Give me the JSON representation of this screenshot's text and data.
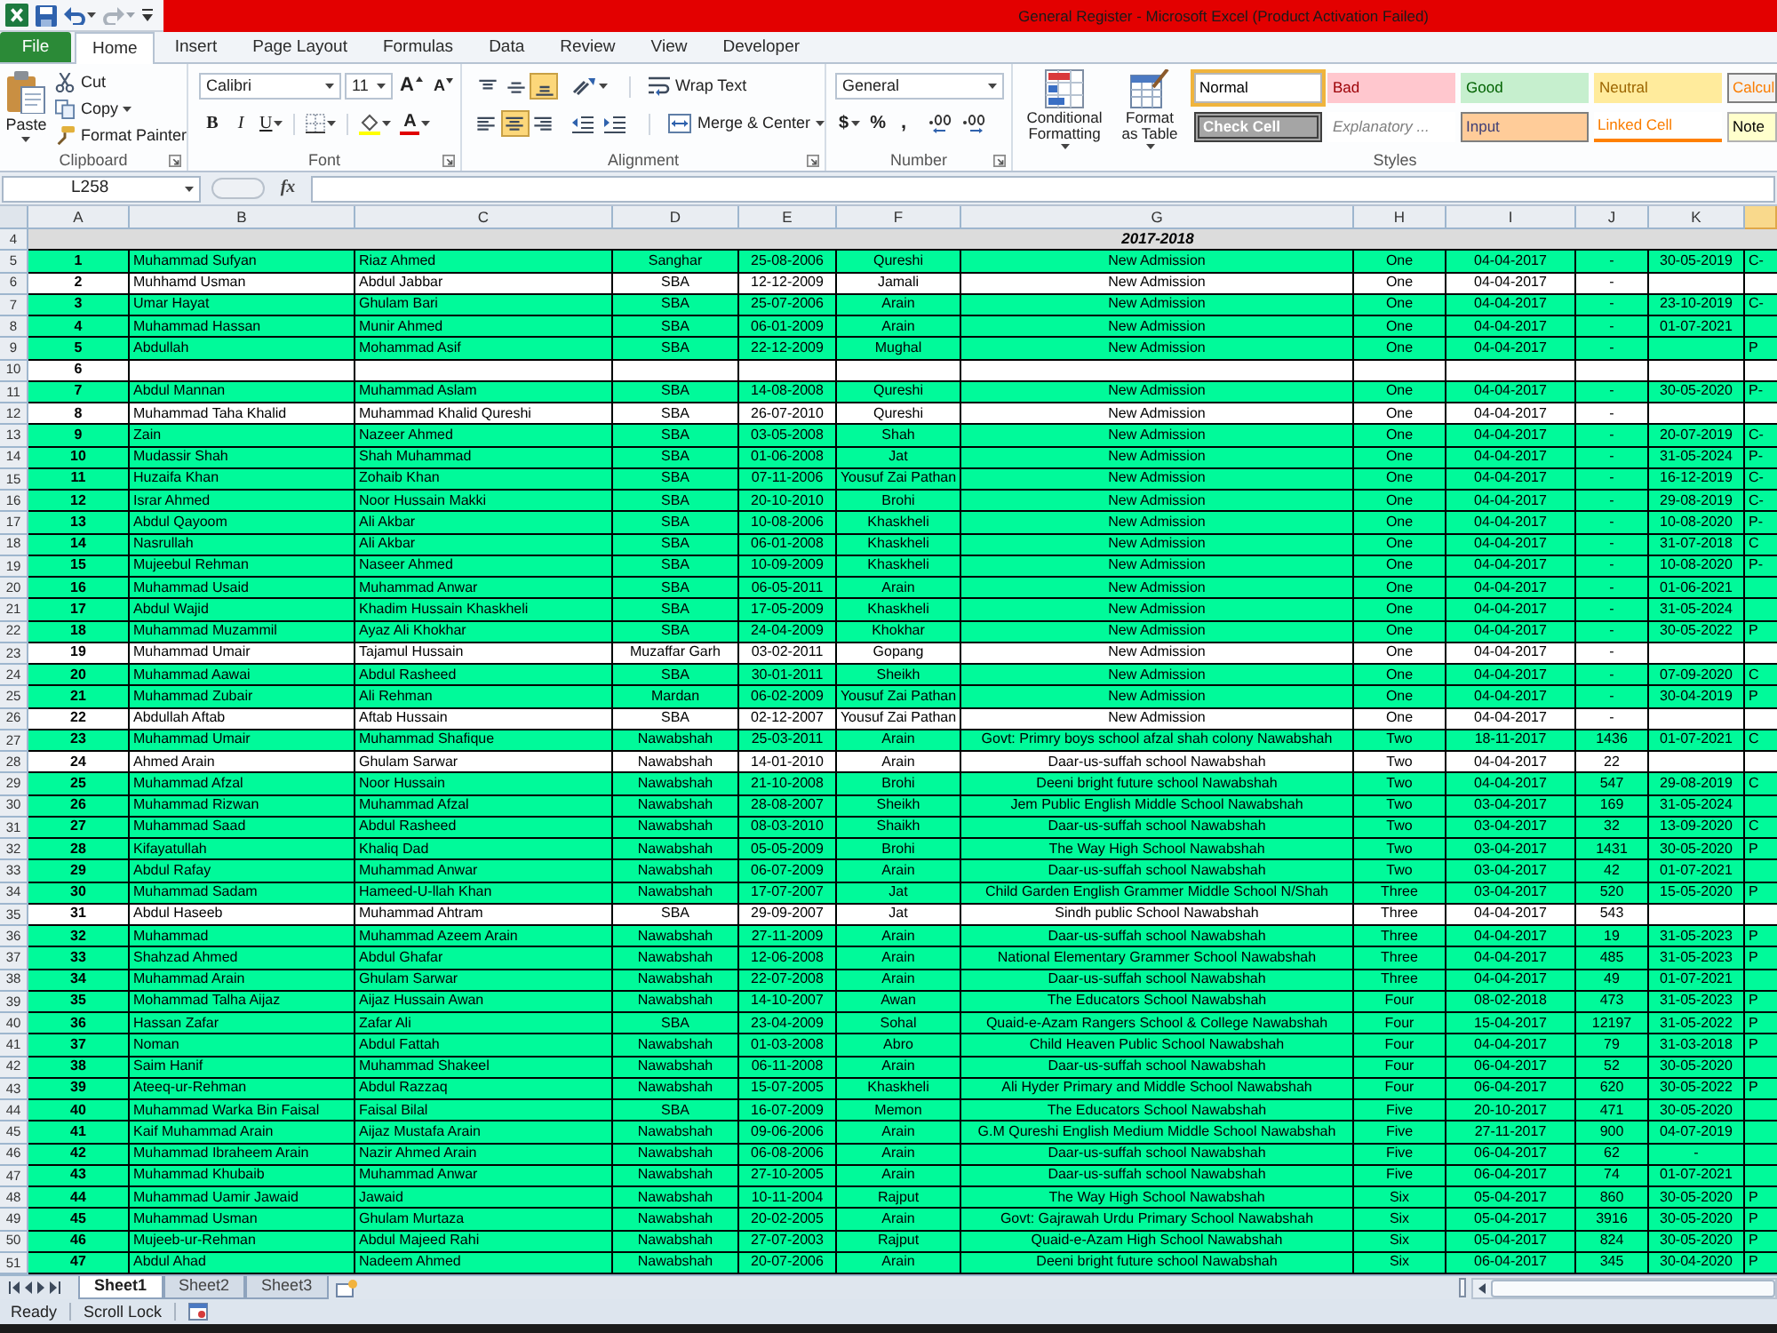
{
  "title_bar": {
    "title": "General Register - Microsoft Excel (Product Activation Failed)"
  },
  "ribbon_tabs": [
    {
      "label": "File",
      "kind": "file",
      "selected": false
    },
    {
      "label": "Home",
      "kind": "tab",
      "selected": true
    },
    {
      "label": "Insert",
      "kind": "tab",
      "selected": false
    },
    {
      "label": "Page Layout",
      "kind": "tab",
      "selected": false
    },
    {
      "label": "Formulas",
      "kind": "tab",
      "selected": false
    },
    {
      "label": "Data",
      "kind": "tab",
      "selected": false
    },
    {
      "label": "Review",
      "kind": "tab",
      "selected": false
    },
    {
      "label": "View",
      "kind": "tab",
      "selected": false
    },
    {
      "label": "Developer",
      "kind": "tab",
      "selected": false
    }
  ],
  "clipboard": {
    "group_label": "Clipboard",
    "paste": "Paste",
    "cut": "Cut",
    "copy": "Copy",
    "format_painter": "Format Painter"
  },
  "font": {
    "group_label": "Font",
    "font_name": "Calibri",
    "font_size": "11",
    "grow": "A",
    "shrink": "A",
    "bold": "B",
    "italic": "I",
    "underline": "U",
    "font_color": "A"
  },
  "alignment": {
    "group_label": "Alignment",
    "buttons": [
      {
        "kind": "top",
        "selected": false
      },
      {
        "kind": "middle",
        "selected": false
      },
      {
        "kind": "bottom",
        "selected": true
      },
      {
        "kind": "left",
        "selected": false
      },
      {
        "kind": "center",
        "selected": true
      },
      {
        "kind": "right",
        "selected": false
      }
    ],
    "wrap_text": "Wrap Text",
    "merge": "Merge & Center"
  },
  "number": {
    "group_label": "Number",
    "format": "General",
    "currency": "$",
    "percent": "%",
    "comma": ","
  },
  "styles": {
    "group_label": "Styles",
    "conditional_formatting": "Conditional Formatting",
    "format_as_table": "Format as Table",
    "cell_styles": [
      {
        "label": "Normal",
        "kind": "normal",
        "selected": true
      },
      {
        "label": "Bad",
        "kind": "bad",
        "selected": false
      },
      {
        "label": "Good",
        "kind": "good",
        "selected": false
      },
      {
        "label": "Neutral",
        "kind": "neutral",
        "selected": false
      },
      {
        "label": "Calcul",
        "kind": "calculation",
        "selected": false
      },
      {
        "label": "Check Cell",
        "kind": "check",
        "selected": false
      },
      {
        "label": "Explanatory ...",
        "kind": "explanatory",
        "selected": false
      },
      {
        "label": "Input",
        "kind": "input",
        "selected": false
      },
      {
        "label": "Linked Cell",
        "kind": "linked",
        "selected": false
      },
      {
        "label": "Note",
        "kind": "note",
        "selected": false
      }
    ]
  },
  "formula_bar": {
    "name_box": "L258",
    "function_label": "fx"
  },
  "columns": [
    {
      "label": "A",
      "selected": false
    },
    {
      "label": "B",
      "selected": false
    },
    {
      "label": "C",
      "selected": false
    },
    {
      "label": "D",
      "selected": false
    },
    {
      "label": "E",
      "selected": false
    },
    {
      "label": "F",
      "selected": false
    },
    {
      "label": "G",
      "selected": false
    },
    {
      "label": "H",
      "selected": false
    },
    {
      "label": "I",
      "selected": false
    },
    {
      "label": "J",
      "selected": false
    },
    {
      "label": "K",
      "selected": false
    },
    {
      "selected": true
    }
  ],
  "title_row": {
    "row_number": "4",
    "cells": {
      "g": "2017-2018"
    }
  },
  "rows": [
    {
      "row_number": "5",
      "highlighted": true,
      "cells": {
        "a": "1",
        "b": "Muhammad Sufyan",
        "c": "Riaz Ahmed",
        "d": "Sanghar",
        "e": "25-08-2006",
        "f": "Qureshi",
        "g": "New Admission",
        "h": "One",
        "i": "04-04-2017",
        "j": "-",
        "k": "30-05-2019",
        "l": "C-"
      }
    },
    {
      "row_number": "6",
      "highlighted": false,
      "cells": {
        "a": "2",
        "b": "Muhhamd Usman",
        "c": "Abdul Jabbar",
        "d": "SBA",
        "e": "12-12-2009",
        "f": "Jamali",
        "g": "New Admission",
        "h": "One",
        "i": "04-04-2017",
        "j": "-"
      }
    },
    {
      "row_number": "7",
      "highlighted": true,
      "cells": {
        "a": "3",
        "b": "Umar Hayat",
        "c": "Ghulam Bari",
        "d": "SBA",
        "e": "25-07-2006",
        "f": "Arain",
        "g": "New Admission",
        "h": "One",
        "i": "04-04-2017",
        "j": "-",
        "k": "23-10-2019",
        "l": "C-"
      }
    },
    {
      "row_number": "8",
      "highlighted": true,
      "cells": {
        "a": "4",
        "b": "Muhammad Hassan",
        "c": "Munir Ahmed",
        "d": "SBA",
        "e": "06-01-2009",
        "f": "Arain",
        "g": "New Admission",
        "h": "One",
        "i": "04-04-2017",
        "j": "-",
        "k": "01-07-2021"
      }
    },
    {
      "row_number": "9",
      "highlighted": true,
      "cells": {
        "a": "5",
        "b": "Abdullah",
        "c": "Mohammad Asif",
        "d": "SBA",
        "e": "22-12-2009",
        "f": "Mughal",
        "g": "New Admission",
        "h": "One",
        "i": "04-04-2017",
        "j": "-",
        "l": "P"
      }
    },
    {
      "row_number": "10",
      "highlighted": false,
      "cells": {
        "a": "6"
      }
    },
    {
      "row_number": "11",
      "highlighted": true,
      "cells": {
        "a": "7",
        "b": "Abdul Mannan",
        "c": "Muhammad Aslam",
        "d": "SBA",
        "e": "14-08-2008",
        "f": "Qureshi",
        "g": "New Admission",
        "h": "One",
        "i": "04-04-2017",
        "j": "-",
        "k": "30-05-2020",
        "l": "P-"
      }
    },
    {
      "row_number": "12",
      "highlighted": false,
      "cells": {
        "a": "8",
        "b": "Muhammad Taha Khalid",
        "c": "Muhammad Khalid Qureshi",
        "d": "SBA",
        "e": "26-07-2010",
        "f": "Qureshi",
        "g": "New Admission",
        "h": "One",
        "i": "04-04-2017",
        "j": "-"
      }
    },
    {
      "row_number": "13",
      "highlighted": true,
      "cells": {
        "a": "9",
        "b": "Zain",
        "c": "Nazeer Ahmed",
        "d": "SBA",
        "e": "03-05-2008",
        "f": "Shah",
        "g": "New Admission",
        "h": "One",
        "i": "04-04-2017",
        "j": "-",
        "k": "20-07-2019",
        "l": "C-"
      }
    },
    {
      "row_number": "14",
      "highlighted": true,
      "cells": {
        "a": "10",
        "b": "Mudassir Shah",
        "c": "Shah Muhammad",
        "d": "SBA",
        "e": "01-06-2008",
        "f": "Jat",
        "g": "New Admission",
        "h": "One",
        "i": "04-04-2017",
        "j": "-",
        "k": "31-05-2024",
        "l": "P-"
      }
    },
    {
      "row_number": "15",
      "highlighted": true,
      "cells": {
        "a": "11",
        "b": "Huzaifa Khan",
        "c": "Zohaib Khan",
        "d": "SBA",
        "e": "07-11-2006",
        "f": "Yousuf Zai Pathan",
        "g": "New Admission",
        "h": "One",
        "i": "04-04-2017",
        "j": "-",
        "k": "16-12-2019",
        "l": "C-"
      }
    },
    {
      "row_number": "16",
      "highlighted": true,
      "cells": {
        "a": "12",
        "b": "Israr Ahmed",
        "c": "Noor Hussain Makki",
        "d": "SBA",
        "e": "20-10-2010",
        "f": "Brohi",
        "g": "New Admission",
        "h": "One",
        "i": "04-04-2017",
        "j": "-",
        "k": "29-08-2019",
        "l": "C-"
      }
    },
    {
      "row_number": "17",
      "highlighted": true,
      "cells": {
        "a": "13",
        "b": "Abdul Qayoom",
        "c": "Ali Akbar",
        "d": "SBA",
        "e": "10-08-2006",
        "f": "Khaskheli",
        "g": "New Admission",
        "h": "One",
        "i": "04-04-2017",
        "j": "-",
        "k": "10-08-2020",
        "l": "P-"
      }
    },
    {
      "row_number": "18",
      "highlighted": true,
      "cells": {
        "a": "14",
        "b": "Nasrullah",
        "c": "Ali Akbar",
        "d": "SBA",
        "e": "06-01-2008",
        "f": "Khaskheli",
        "g": "New Admission",
        "h": "One",
        "i": "04-04-2017",
        "j": "-",
        "k": "31-07-2018",
        "l": "C"
      }
    },
    {
      "row_number": "19",
      "highlighted": true,
      "cells": {
        "a": "15",
        "b": "Mujeebul Rehman",
        "c": "Naseer Ahmed",
        "d": "SBA",
        "e": "10-09-2009",
        "f": "Khaskheli",
        "g": "New Admission",
        "h": "One",
        "i": "04-04-2017",
        "j": "-",
        "k": "10-08-2020",
        "l": "P-"
      }
    },
    {
      "row_number": "20",
      "highlighted": true,
      "cells": {
        "a": "16",
        "b": "Muhammad Usaid",
        "c": "Muhammad Anwar",
        "d": "SBA",
        "e": "06-05-2011",
        "f": "Arain",
        "g": "New Admission",
        "h": "One",
        "i": "04-04-2017",
        "j": "-",
        "k": "01-06-2021"
      }
    },
    {
      "row_number": "21",
      "highlighted": true,
      "cells": {
        "a": "17",
        "b": "Abdul Wajid",
        "c": "Khadim Hussain Khaskheli",
        "d": "SBA",
        "e": "17-05-2009",
        "f": "Khaskheli",
        "g": "New Admission",
        "h": "One",
        "i": "04-04-2017",
        "j": "-",
        "k": "31-05-2024"
      }
    },
    {
      "row_number": "22",
      "highlighted": true,
      "cells": {
        "a": "18",
        "b": "Muhammad Muzammil",
        "c": "Ayaz Ali Khokhar",
        "d": "SBA",
        "e": "24-04-2009",
        "f": "Khokhar",
        "g": "New Admission",
        "h": "One",
        "i": "04-04-2017",
        "j": "-",
        "k": "30-05-2022",
        "l": "P"
      }
    },
    {
      "row_number": "23",
      "highlighted": false,
      "cells": {
        "a": "19",
        "b": "Muhammad Umair",
        "c": "Tajamul Hussain",
        "d": "Muzaffar Garh",
        "e": "03-02-2011",
        "f": "Gopang",
        "g": "New Admission",
        "h": "One",
        "i": "04-04-2017",
        "j": "-"
      }
    },
    {
      "row_number": "24",
      "highlighted": true,
      "cells": {
        "a": "20",
        "b": "Muhammad Aawai",
        "c": "Abdul Rasheed",
        "d": "SBA",
        "e": "30-01-2011",
        "f": "Sheikh",
        "g": "New Admission",
        "h": "One",
        "i": "04-04-2017",
        "j": "-",
        "k": "07-09-2020",
        "l": "C"
      }
    },
    {
      "row_number": "25",
      "highlighted": true,
      "cells": {
        "a": "21",
        "b": "Muhammad Zubair",
        "c": "Ali Rehman",
        "d": "Mardan",
        "e": "06-02-2009",
        "f": "Yousuf Zai Pathan",
        "g": "New Admission",
        "h": "One",
        "i": "04-04-2017",
        "j": "-",
        "k": "30-04-2019",
        "l": "P"
      }
    },
    {
      "row_number": "26",
      "highlighted": false,
      "cells": {
        "a": "22",
        "b": "Abdullah Aftab",
        "c": "Aftab Hussain",
        "d": "SBA",
        "e": "02-12-2007",
        "f": "Yousuf Zai Pathan",
        "g": "New Admission",
        "h": "One",
        "i": "04-04-2017",
        "j": "-"
      }
    },
    {
      "row_number": "27",
      "highlighted": true,
      "cells": {
        "a": "23",
        "b": "Muhammad Umair",
        "c": "Muhammad Shafique",
        "d": "Nawabshah",
        "e": "25-03-2011",
        "f": "Arain",
        "g": "Govt: Primry boys school afzal shah colony Nawabshah",
        "h": "Two",
        "i": "18-11-2017",
        "j": "1436",
        "k": "01-07-2021",
        "l": "C"
      }
    },
    {
      "row_number": "28",
      "highlighted": false,
      "cells": {
        "a": "24",
        "b": "Ahmed Arain",
        "c": "Ghulam Sarwar",
        "d": "Nawabshah",
        "e": "14-01-2010",
        "f": "Arain",
        "g": "Daar-us-suffah school Nawabshah",
        "h": "Two",
        "i": "04-04-2017",
        "j": "22"
      }
    },
    {
      "row_number": "29",
      "highlighted": true,
      "cells": {
        "a": "25",
        "b": "Muhammad Afzal",
        "c": "Noor Hussain",
        "d": "Nawabshah",
        "e": "21-10-2008",
        "f": "Brohi",
        "g": "Deeni bright future school Nawabshah",
        "h": "Two",
        "i": "04-04-2017",
        "j": "547",
        "k": "29-08-2019",
        "l": "C"
      }
    },
    {
      "row_number": "30",
      "highlighted": true,
      "cells": {
        "a": "26",
        "b": "Muhammad Rizwan",
        "c": "Muhammad Afzal",
        "d": "Nawabshah",
        "e": "28-08-2007",
        "f": "Sheikh",
        "g": "Jem Public English Middle School Nawabshah",
        "h": "Two",
        "i": "03-04-2017",
        "j": "169",
        "k": "31-05-2024"
      }
    },
    {
      "row_number": "31",
      "highlighted": true,
      "cells": {
        "a": "27",
        "b": "Muhammad Saad",
        "c": "Abdul Rasheed",
        "d": "Nawabshah",
        "e": "08-03-2010",
        "f": "Shaikh",
        "g": "Daar-us-suffah school Nawabshah",
        "h": "Two",
        "i": "03-04-2017",
        "j": "32",
        "k": "13-09-2020",
        "l": "C"
      }
    },
    {
      "row_number": "32",
      "highlighted": true,
      "cells": {
        "a": "28",
        "b": "Kifayatullah",
        "c": "Khaliq Dad",
        "d": "Nawabshah",
        "e": "05-05-2009",
        "f": "Brohi",
        "g": "The Way High School Nawabshah",
        "h": "Two",
        "i": "03-04-2017",
        "j": "1431",
        "k": "30-05-2020",
        "l": "P"
      }
    },
    {
      "row_number": "33",
      "highlighted": true,
      "cells": {
        "a": "29",
        "b": "Abdul Rafay",
        "c": "Muhammad Anwar",
        "d": "Nawabshah",
        "e": "06-07-2009",
        "f": "Arain",
        "g": "Daar-us-suffah school Nawabshah",
        "h": "Two",
        "i": "03-04-2017",
        "j": "42",
        "k": "01-07-2021"
      }
    },
    {
      "row_number": "34",
      "highlighted": true,
      "cells": {
        "a": "30",
        "b": "Muhammad Sadam",
        "c": "Hameed-U-llah Khan",
        "d": "Nawabshah",
        "e": "17-07-2007",
        "f": "Jat",
        "g": "Child Garden English Grammer Middle School N/Shah",
        "h": "Three",
        "i": "03-04-2017",
        "j": "520",
        "k": "15-05-2020",
        "l": "P"
      }
    },
    {
      "row_number": "35",
      "highlighted": false,
      "cells": {
        "a": "31",
        "b": "Abdul Haseeb",
        "c": "Muhammad Ahtram",
        "d": "SBA",
        "e": "29-09-2007",
        "f": "Jat",
        "g": "Sindh public School Nawabshah",
        "h": "Three",
        "i": "04-04-2017",
        "j": "543"
      }
    },
    {
      "row_number": "36",
      "highlighted": true,
      "cells": {
        "a": "32",
        "b": "Muhammad",
        "c": "Muhammad Azeem Arain",
        "d": "Nawabshah",
        "e": "27-11-2009",
        "f": "Arain",
        "g": "Daar-us-suffah school Nawabshah",
        "h": "Three",
        "i": "04-04-2017",
        "j": "19",
        "k": "31-05-2023",
        "l": "P"
      }
    },
    {
      "row_number": "37",
      "highlighted": true,
      "cells": {
        "a": "33",
        "b": "Shahzad Ahmed",
        "c": "Abdul Ghafar",
        "d": "Nawabshah",
        "e": "12-06-2008",
        "f": "Arain",
        "g": "National Elementary Grammer School Nawabshah",
        "h": "Three",
        "i": "04-04-2017",
        "j": "485",
        "k": "31-05-2023",
        "l": "P"
      }
    },
    {
      "row_number": "38",
      "highlighted": true,
      "cells": {
        "a": "34",
        "b": "Muhammad Arain",
        "c": "Ghulam Sarwar",
        "d": "Nawabshah",
        "e": "22-07-2008",
        "f": "Arain",
        "g": "Daar-us-suffah school Nawabshah",
        "h": "Three",
        "i": "04-04-2017",
        "j": "49",
        "k": "01-07-2021"
      }
    },
    {
      "row_number": "39",
      "highlighted": true,
      "cells": {
        "a": "35",
        "b": "Mohammad Talha Aijaz",
        "c": "Aijaz Hussain Awan",
        "d": "Nawabshah",
        "e": "14-10-2007",
        "f": "Awan",
        "g": "The Educators School Nawabshah",
        "h": "Four",
        "i": "08-02-2018",
        "j": "473",
        "k": "31-05-2023",
        "l": "P"
      }
    },
    {
      "row_number": "40",
      "highlighted": true,
      "cells": {
        "a": "36",
        "b": "Hassan Zafar",
        "c": "Zafar Ali",
        "d": "SBA",
        "e": "23-04-2009",
        "f": "Sohal",
        "g": "Quaid-e-Azam Rangers School & College Nawabshah",
        "h": "Four",
        "i": "15-04-2017",
        "j": "12197",
        "k": "31-05-2022",
        "l": "P"
      }
    },
    {
      "row_number": "41",
      "highlighted": true,
      "cells": {
        "a": "37",
        "b": "Noman",
        "c": "Abdul Fattah",
        "d": "Nawabshah",
        "e": "01-03-2008",
        "f": "Abro",
        "g": "Child Heaven Public School Nawabshah",
        "h": "Four",
        "i": "04-04-2017",
        "j": "79",
        "k": "31-03-2018",
        "l": "P"
      }
    },
    {
      "row_number": "42",
      "highlighted": true,
      "cells": {
        "a": "38",
        "b": "Saim Hanif",
        "c": "Muhammad Shakeel",
        "d": "Nawabshah",
        "e": "06-11-2008",
        "f": "Arain",
        "g": "Daar-us-suffah school Nawabshah",
        "h": "Four",
        "i": "06-04-2017",
        "j": "52",
        "k": "30-05-2020"
      }
    },
    {
      "row_number": "43",
      "highlighted": true,
      "cells": {
        "a": "39",
        "b": "Ateeq-ur-Rehman",
        "c": "Abdul Razzaq",
        "d": "Nawabshah",
        "e": "15-07-2005",
        "f": "Khaskheli",
        "g": "Ali Hyder Primary and Middle School Nawabshah",
        "h": "Four",
        "i": "06-04-2017",
        "j": "620",
        "k": "30-05-2022",
        "l": "P"
      }
    },
    {
      "row_number": "44",
      "highlighted": true,
      "cells": {
        "a": "40",
        "b": "Muhammad Warka Bin Faisal",
        "c": "Faisal Bilal",
        "d": "SBA",
        "e": "16-07-2009",
        "f": "Memon",
        "g": "The Educators School Nawabshah",
        "h": "Five",
        "i": "20-10-2017",
        "j": "471",
        "k": "30-05-2020"
      }
    },
    {
      "row_number": "45",
      "highlighted": true,
      "cells": {
        "a": "41",
        "b": "Kaif Muhammad Arain",
        "c": "Aijaz Mustafa Arain",
        "d": "Nawabshah",
        "e": "09-06-2006",
        "f": "Arain",
        "g": "G.M Qureshi English Medium Middle School Nawabshah",
        "h": "Five",
        "i": "27-11-2017",
        "j": "900",
        "k": "04-07-2019"
      }
    },
    {
      "row_number": "46",
      "highlighted": true,
      "cells": {
        "a": "42",
        "b": "Muhammad Ibraheem Arain",
        "c": "Nazir Ahmed Arain",
        "d": "Nawabshah",
        "e": "06-08-2006",
        "f": "Arain",
        "g": "Daar-us-suffah school Nawabshah",
        "h": "Five",
        "i": "06-04-2017",
        "j": "62",
        "k": "-"
      }
    },
    {
      "row_number": "47",
      "highlighted": true,
      "cells": {
        "a": "43",
        "b": "Muhammad Khubaib",
        "c": "Muhammad Anwar",
        "d": "Nawabshah",
        "e": "27-10-2005",
        "f": "Arain",
        "g": "Daar-us-suffah school Nawabshah",
        "h": "Five",
        "i": "06-04-2017",
        "j": "74",
        "k": "01-07-2021"
      }
    },
    {
      "row_number": "48",
      "highlighted": true,
      "cells": {
        "a": "44",
        "b": "Muhammad Uamir Jawaid",
        "c": "Jawaid",
        "d": "Nawabshah",
        "e": "10-11-2004",
        "f": "Rajput",
        "g": "The Way High School Nawabshah",
        "h": "Six",
        "i": "05-04-2017",
        "j": "860",
        "k": "30-05-2020",
        "l": "P"
      }
    },
    {
      "row_number": "49",
      "highlighted": true,
      "cells": {
        "a": "45",
        "b": "Muhammad Usman",
        "c": "Ghulam Murtaza",
        "d": "Nawabshah",
        "e": "20-02-2005",
        "f": "Arain",
        "g": "Govt: Gajrawah Urdu Primary School Nawabshah",
        "h": "Six",
        "i": "05-04-2017",
        "j": "3916",
        "k": "30-05-2020",
        "l": "P"
      }
    },
    {
      "row_number": "50",
      "highlighted": true,
      "cells": {
        "a": "46",
        "b": "Mujeeb-ur-Rehman",
        "c": "Abdul Majeed Rahi",
        "d": "Nawabshah",
        "e": "27-07-2003",
        "f": "Rajput",
        "g": "Quaid-e-Azam High School Nawabshah",
        "h": "Six",
        "i": "05-04-2017",
        "j": "824",
        "k": "30-05-2020",
        "l": "P"
      }
    },
    {
      "row_number": "51",
      "highlighted": true,
      "cells": {
        "a": "47",
        "b": "Abdul Ahad",
        "c": "Nadeem Ahmed",
        "d": "Nawabshah",
        "e": "20-07-2006",
        "f": "Arain",
        "g": "Deeni bright future school Nawabshah",
        "h": "Six",
        "i": "06-04-2017",
        "j": "345",
        "k": "30-04-2020",
        "l": "P"
      }
    }
  ],
  "sheet_tabs": [
    {
      "label": "Sheet1",
      "selected": true
    },
    {
      "label": "Sheet2",
      "selected": false
    },
    {
      "label": "Sheet3",
      "selected": false
    }
  ],
  "status_bar": {
    "items": [
      "Ready",
      "Scroll Lock"
    ]
  }
}
